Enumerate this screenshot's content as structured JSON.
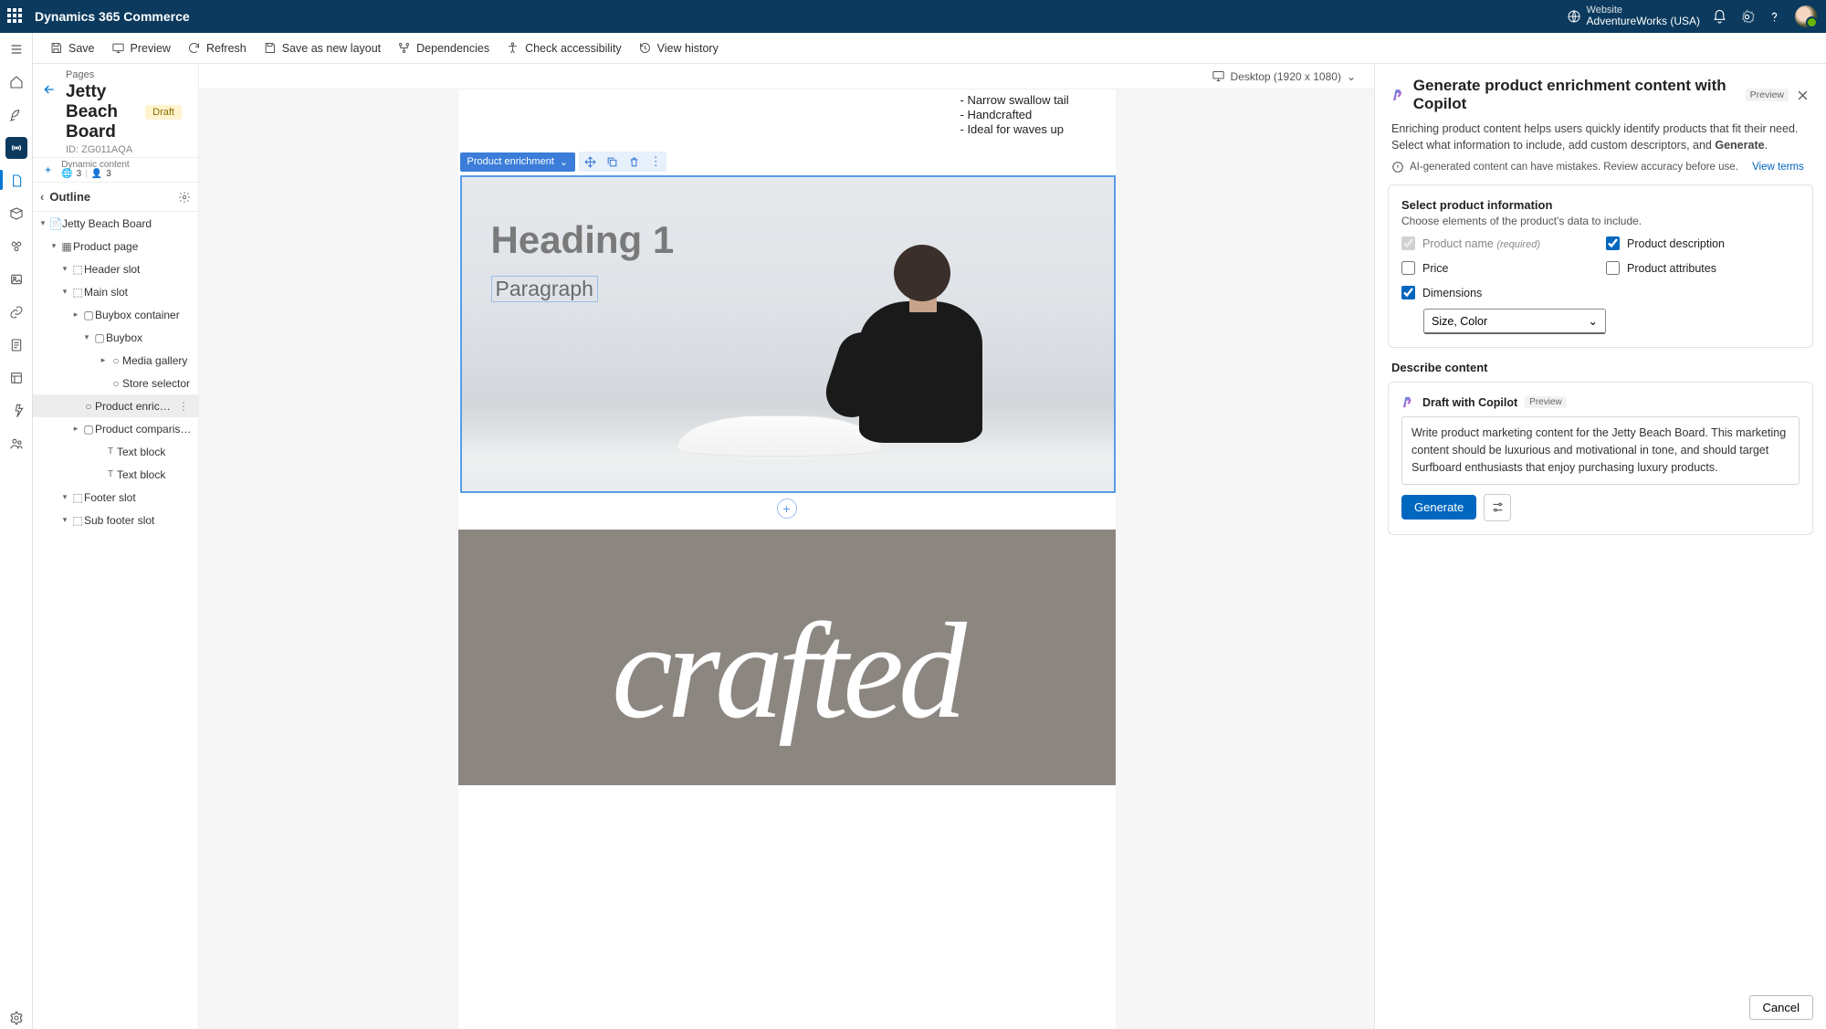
{
  "topbar": {
    "app_title": "Dynamics 365 Commerce",
    "website_label": "Website",
    "website_value": "AdventureWorks (USA)"
  },
  "commands": {
    "save": "Save",
    "preview": "Preview",
    "refresh": "Refresh",
    "save_layout": "Save as new layout",
    "dependencies": "Dependencies",
    "accessibility": "Check accessibility",
    "history": "View history"
  },
  "breadcrumb": {
    "pages": "Pages",
    "title": "Jetty Beach Board",
    "status": "Draft",
    "id_label": "ID: ZG011AQA"
  },
  "dynamic": {
    "label": "Dynamic content",
    "count1": "3",
    "count2": "3",
    "viewport": "Desktop (1920 x 1080)"
  },
  "outline": {
    "header": "Outline",
    "nodes": {
      "root": "Jetty Beach Board",
      "product_page": "Product page",
      "header_slot": "Header slot",
      "main_slot": "Main slot",
      "buybox_container": "Buybox container",
      "buybox": "Buybox",
      "media_gallery": "Media gallery",
      "store_selector": "Store selector",
      "product_enrichment": "Product enrichment",
      "product_comparison": "Product comparison bu...",
      "text_block1": "Text block",
      "text_block2": "Text block",
      "footer_slot": "Footer slot",
      "sub_footer_slot": "Sub footer slot"
    }
  },
  "canvas": {
    "bullets": [
      "- Narrow swallow tail",
      "- Handcrafted",
      "- Ideal for waves up"
    ],
    "sel_label": "Product enrichment",
    "heading": "Heading 1",
    "paragraph": "Paragraph",
    "crafted": "crafted"
  },
  "panel": {
    "title": "Generate product enrichment content with Copilot",
    "preview": "Preview",
    "desc_1": "Enriching product content helps users quickly identify products that fit their need. Select what information to include, add custom descriptors, and ",
    "desc_bold": "Generate",
    "desc_end": ".",
    "warn": "AI-generated content can have mistakes. Review accuracy before use.",
    "view_terms": "View terms",
    "select_info": "Select product information",
    "select_desc": "Choose elements of the product's data to include.",
    "chk_name": "Product name",
    "chk_name_req": "(required)",
    "chk_desc": "Product description",
    "chk_price": "Price",
    "chk_attr": "Product attributes",
    "chk_dim": "Dimensions",
    "dim_value": "Size, Color",
    "describe": "Describe content",
    "draft_label": "Draft with Copilot",
    "prompt": "Write product marketing content for the Jetty Beach Board. This marketing content should be luxurious and motivational in tone, and should target Surfboard enthusiasts that enjoy purchasing luxury products.",
    "generate": "Generate",
    "cancel": "Cancel"
  }
}
